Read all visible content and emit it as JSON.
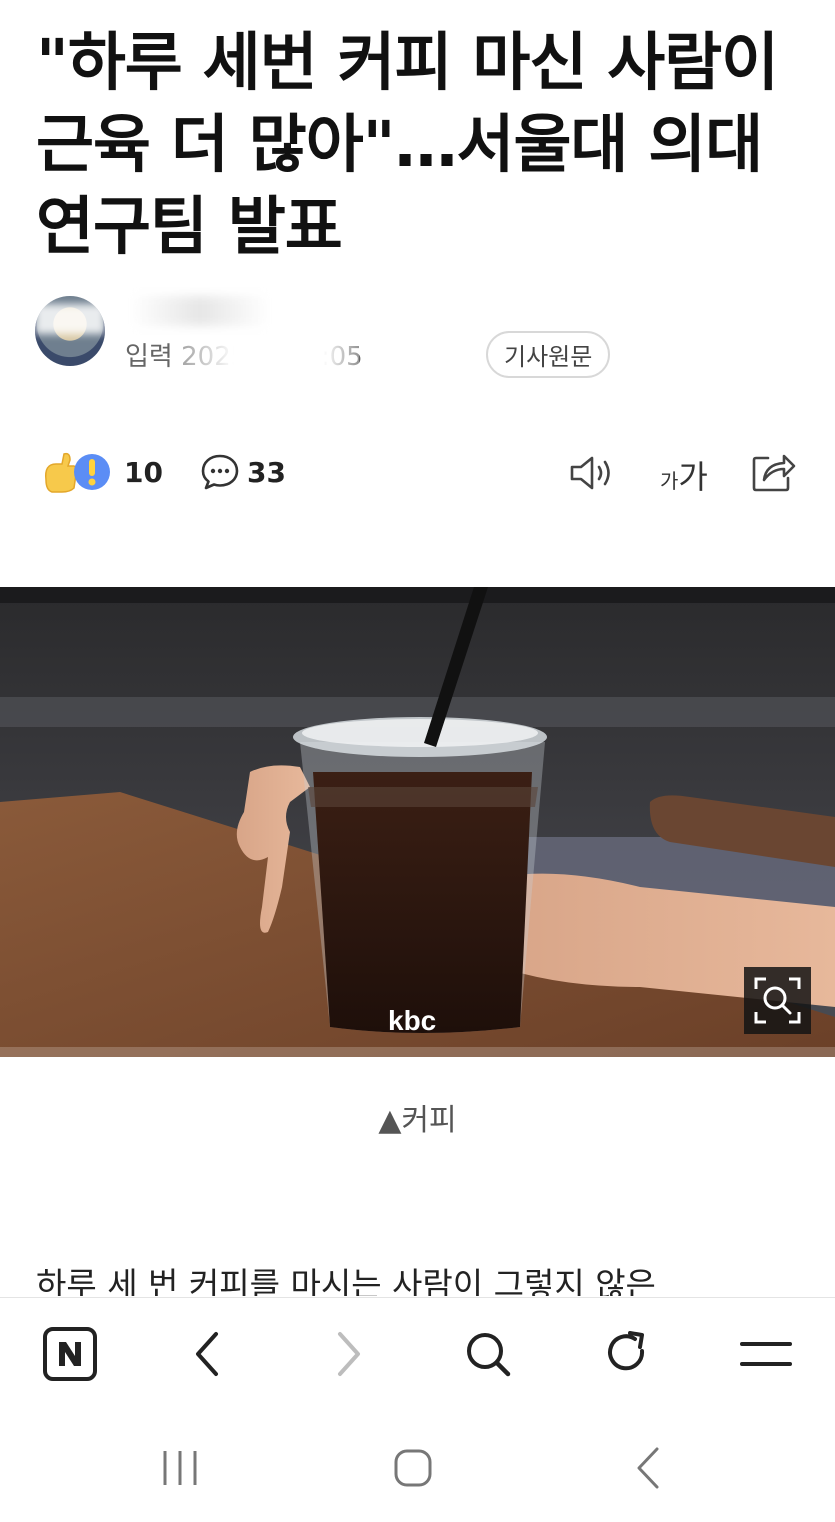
{
  "article": {
    "title": "\"하루 세번 커피 마신 사람이 근육 더 많아\"…서울대 의대 연구팀 발표",
    "date_visible": "입력 2025   2후 6:05",
    "source_button": "기사원문"
  },
  "actions": {
    "reaction_count": "10",
    "comment_count": "33",
    "font_size_label_small": "가",
    "font_size_label_large": "가"
  },
  "image": {
    "watermark": "kbc",
    "caption": "▲커피"
  },
  "body": {
    "first_line": "하루 세 번 커피를 마시는 사람이 그렇지 않은"
  },
  "icons": {
    "reaction": "reaction-emoji-icon",
    "comment": "comment-icon",
    "speaker": "speaker-icon",
    "share": "share-icon",
    "zoom": "image-zoom-icon",
    "naver": "naver-n-icon",
    "back": "back-arrow-icon",
    "forward": "forward-arrow-icon",
    "search": "search-icon",
    "refresh": "refresh-icon",
    "menu": "menu-icon"
  }
}
